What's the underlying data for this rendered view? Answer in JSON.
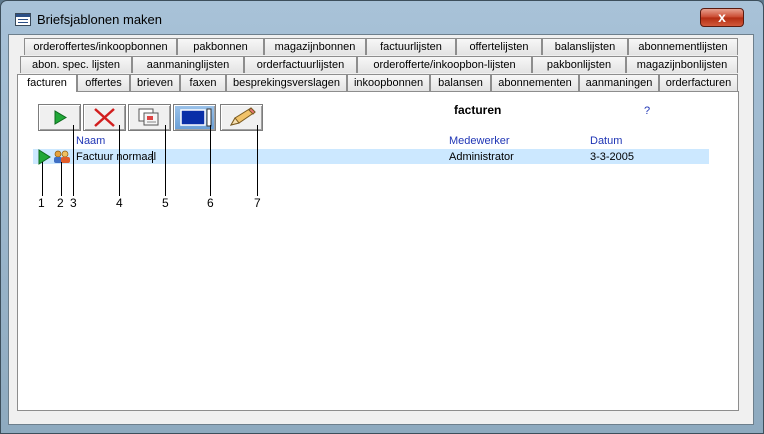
{
  "window": {
    "title": "Briefsjablonen maken",
    "close_label": "x"
  },
  "tabs": {
    "row1": [
      "orderoffertes/inkoopbonnen",
      "pakbonnen",
      "magazijnbonnen",
      "factuurlijsten",
      "offertelijsten",
      "balanslijsten",
      "abonnementlijsten"
    ],
    "row2": [
      "abon. spec. lijsten",
      "aanmaninglijsten",
      "orderfactuurlijsten",
      "orderofferte/inkoopbon-lijsten",
      "pakbonlijsten",
      "magazijnbonlijsten"
    ],
    "row3": [
      "facturen",
      "offertes",
      "brieven",
      "faxen",
      "besprekingsverslagen",
      "inkoopbonnen",
      "balansen",
      "abonnementen",
      "aanmaningen",
      "orderfacturen"
    ],
    "active": "facturen"
  },
  "panel": {
    "heading": "facturen",
    "help": "?",
    "columns": {
      "name": "Naam",
      "employee": "Medewerker",
      "date": "Datum"
    },
    "rows": [
      {
        "name": "Factuur normaal",
        "employee": "Administrator",
        "date": "3-3-2005"
      }
    ]
  },
  "toolbar": {
    "icons": [
      "play-icon",
      "delete-icon",
      "copy-template-icon",
      "screen-icon",
      "edit-pencil-icon"
    ]
  },
  "callouts": [
    "1",
    "2",
    "3",
    "4",
    "5",
    "6",
    "7"
  ]
}
